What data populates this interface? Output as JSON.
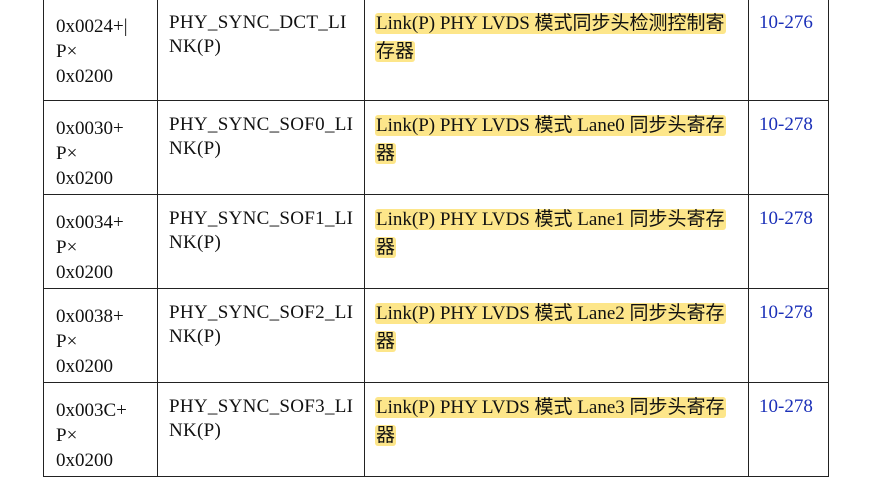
{
  "rows": [
    {
      "offset": "0x0024+|\nP×\n0x0200",
      "name": "PHY_SYNC_DCT_LINK(P)",
      "description": "Link(P) PHY LVDS 模式同步头检测控制寄存器",
      "page": "10-276"
    },
    {
      "offset": "0x0030+\nP×\n0x0200",
      "name": "PHY_SYNC_SOF0_LINK(P)",
      "description": "Link(P) PHY LVDS 模式 Lane0 同步头寄存器",
      "page": "10-278"
    },
    {
      "offset": "0x0034+\nP×\n0x0200",
      "name": "PHY_SYNC_SOF1_LINK(P)",
      "description": "Link(P) PHY LVDS 模式 Lane1 同步头寄存器",
      "page": "10-278"
    },
    {
      "offset": "0x0038+\nP×\n0x0200",
      "name": "PHY_SYNC_SOF2_LINK(P)",
      "description": "Link(P) PHY LVDS 模式 Lane2 同步头寄存器",
      "page": "10-278"
    },
    {
      "offset": "0x003C+\nP×\n0x0200",
      "name": "PHY_SYNC_SOF3_LINK(P)",
      "description": "Link(P) PHY LVDS 模式 Lane3 同步头寄存器",
      "page": "10-278"
    }
  ],
  "colors": {
    "highlight": "#fde68a",
    "link": "#1a2fb8",
    "border": "#222222"
  }
}
